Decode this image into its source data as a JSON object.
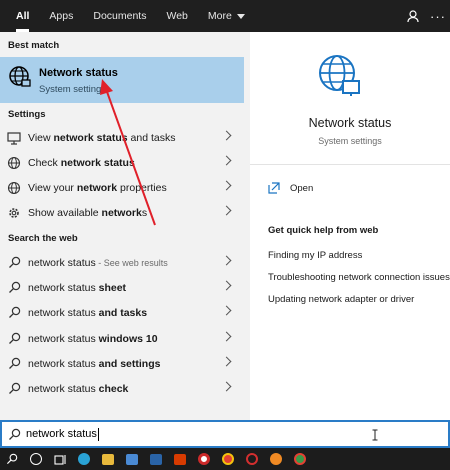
{
  "tabs": [
    {
      "label": "All",
      "active": true
    },
    {
      "label": "Apps"
    },
    {
      "label": "Documents"
    },
    {
      "label": "Web"
    },
    {
      "label": "More"
    }
  ],
  "sections": {
    "best_match": "Best match",
    "settings": "Settings",
    "search_web": "Search the web"
  },
  "best_match": {
    "title": "Network status",
    "subtitle": "System settings",
    "icon": "globe-icon"
  },
  "settings_items": [
    {
      "pre": "View ",
      "bold": "network status",
      "post": " and tasks",
      "icon": "network-icon"
    },
    {
      "pre": "Check ",
      "bold": "network status",
      "post": "",
      "icon": "globe-icon"
    },
    {
      "pre": "View your ",
      "bold": "network",
      "post": " properties",
      "icon": "globe-icon"
    },
    {
      "pre": "Show available ",
      "bold": "network",
      "post": "s",
      "icon": "gear-icon"
    }
  ],
  "web_items": [
    {
      "pre": "network status",
      "bold": "",
      "post": "",
      "muted": " - See web results"
    },
    {
      "pre": "network status ",
      "bold": "sheet",
      "post": ""
    },
    {
      "pre": "network status ",
      "bold": "and tasks",
      "post": ""
    },
    {
      "pre": "network status ",
      "bold": "windows 10",
      "post": ""
    },
    {
      "pre": "network status ",
      "bold": "and settings",
      "post": ""
    },
    {
      "pre": "network status ",
      "bold": "check",
      "post": ""
    }
  ],
  "preview": {
    "title": "Network status",
    "subtitle": "System settings",
    "open_label": "Open",
    "help_heading": "Get quick help from web",
    "links": [
      "Finding my IP address",
      "Troubleshooting network connection issues",
      "Updating network adapter or driver"
    ]
  },
  "search": {
    "value": "network status",
    "icon": "search-icon"
  },
  "colors": {
    "accent": "#2a7cc7",
    "highlight": "#a9cfeb",
    "arrow": "#e0202a",
    "dark_bar": "#1f1f1f"
  },
  "taskbar": [
    {
      "name": "search-icon"
    },
    {
      "name": "cortana-icon"
    },
    {
      "name": "task-view-icon"
    },
    {
      "name": "edge-icon",
      "color": "#2aa3d6"
    },
    {
      "name": "file-explorer-icon",
      "color": "#e8b93c"
    },
    {
      "name": "store-icon",
      "color": "#4a8ad4"
    },
    {
      "name": "mail-icon",
      "color": "#2a64a8"
    },
    {
      "name": "office-icon",
      "color": "#d83b01"
    },
    {
      "name": "record-icon",
      "color": "#cc2a2a"
    },
    {
      "name": "chrome-icon",
      "color": "#e34133"
    },
    {
      "name": "opera-icon",
      "color": "#d32f2f"
    },
    {
      "name": "firefox-icon",
      "color": "#f08a24"
    },
    {
      "name": "chrome-alt-icon",
      "color": "#3a9a4a"
    }
  ]
}
